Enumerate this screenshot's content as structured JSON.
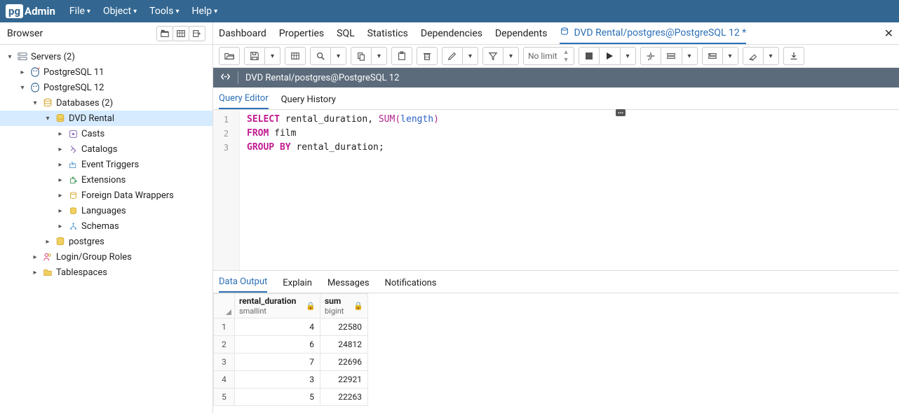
{
  "app": {
    "name": "Admin",
    "prefix": "pg"
  },
  "menus": [
    "File",
    "Object",
    "Tools",
    "Help"
  ],
  "browser": {
    "title": "Browser",
    "root": "Servers (2)",
    "nodes": {
      "pg11": "PostgreSQL 11",
      "pg12": "PostgreSQL 12",
      "databases": "Databases (2)",
      "dvdrental": "DVD Rental",
      "casts": "Casts",
      "catalogs": "Catalogs",
      "eventtriggers": "Event Triggers",
      "extensions": "Extensions",
      "fdw": "Foreign Data Wrappers",
      "languages": "Languages",
      "schemas": "Schemas",
      "postgres": "postgres",
      "loginroles": "Login/Group Roles",
      "tablespaces": "Tablespaces"
    }
  },
  "tabs": {
    "dashboard": "Dashboard",
    "properties": "Properties",
    "sql": "SQL",
    "statistics": "Statistics",
    "dependencies": "Dependencies",
    "dependents": "Dependents",
    "querytool": "DVD Rental/postgres@PostgreSQL 12 *"
  },
  "toolbar": {
    "nolimit": "No limit"
  },
  "connection": {
    "label": "DVD Rental/postgres@PostgreSQL 12"
  },
  "inner_tabs": {
    "editor": "Query Editor",
    "history": "Query History"
  },
  "code": {
    "l1a": "SELECT",
    "l1b": " rental_duration, ",
    "l1c": "SUM",
    "l1d": "(",
    "l1e": "length",
    "l1f": ")",
    "l2a": "FROM",
    "l2b": " film",
    "l3a": "GROUP BY",
    "l3b": " rental_duration;"
  },
  "out_tabs": {
    "data": "Data Output",
    "explain": "Explain",
    "messages": "Messages",
    "notifications": "Notifications"
  },
  "grid": {
    "columns": [
      {
        "name": "rental_duration",
        "type": "smallint"
      },
      {
        "name": "sum",
        "type": "bigint"
      }
    ],
    "rows": [
      {
        "n": "1",
        "c1": "4",
        "c2": "22580"
      },
      {
        "n": "2",
        "c1": "6",
        "c2": "24812"
      },
      {
        "n": "3",
        "c1": "7",
        "c2": "22696"
      },
      {
        "n": "4",
        "c1": "3",
        "c2": "22921"
      },
      {
        "n": "5",
        "c1": "5",
        "c2": "22263"
      }
    ]
  }
}
